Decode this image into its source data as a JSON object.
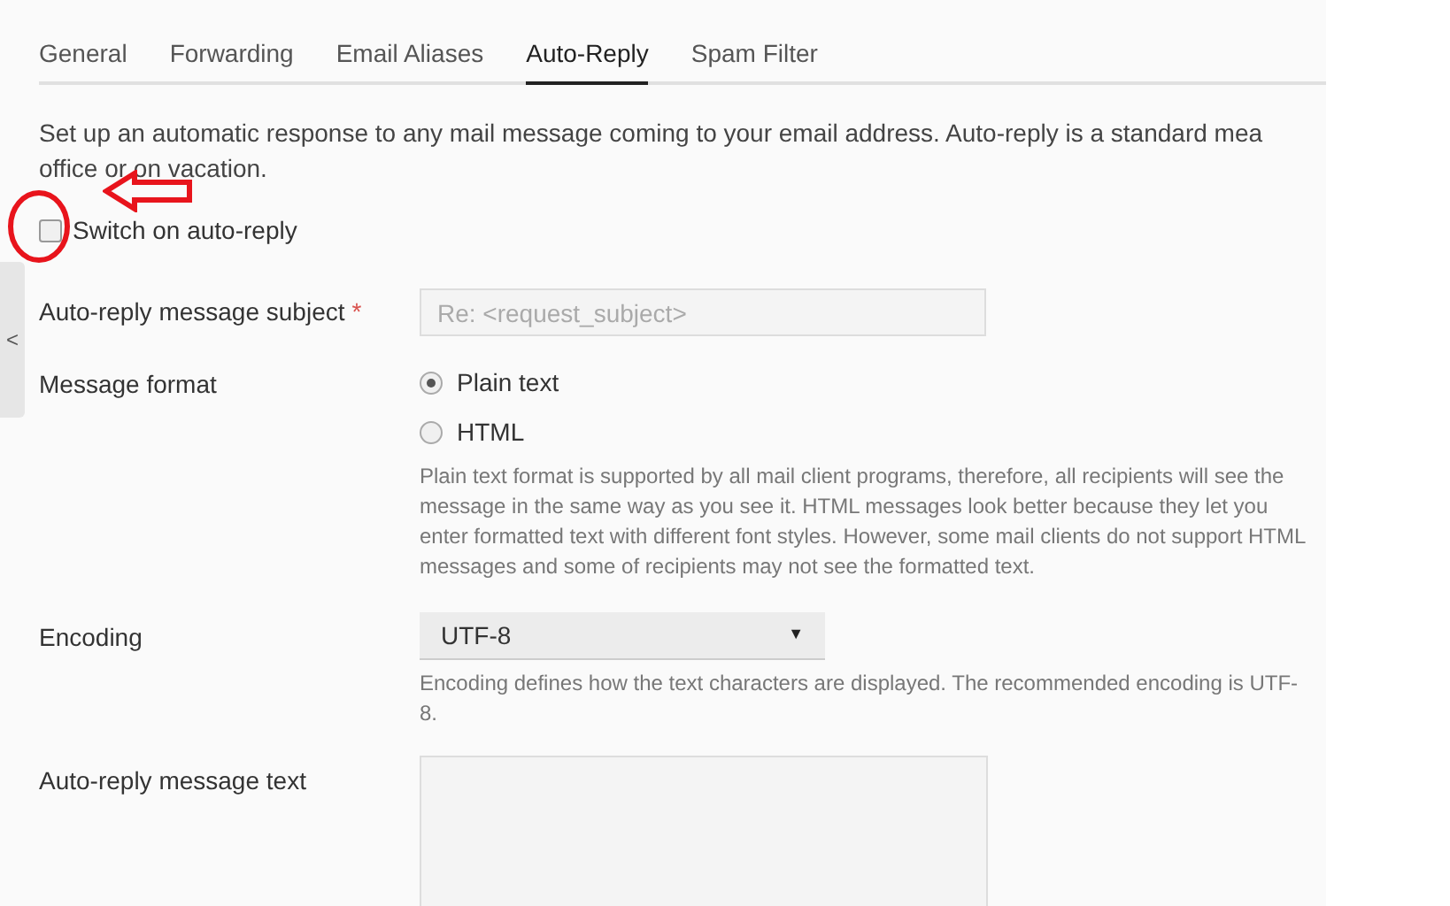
{
  "tabs": [
    {
      "label": "General",
      "selected": false
    },
    {
      "label": "Forwarding",
      "selected": false
    },
    {
      "label": "Email Aliases",
      "selected": false
    },
    {
      "label": "Auto-Reply",
      "selected": true
    },
    {
      "label": "Spam Filter",
      "selected": false
    }
  ],
  "intro": [
    "Set up an automatic response to any mail message coming to your email address. Auto-reply is a standard mea",
    "office or on vacation."
  ],
  "switch": {
    "label": "Switch on auto-reply",
    "checked": false
  },
  "sidebar_toggle": "<",
  "subject": {
    "label": "Auto-reply message subject",
    "required_mark": "*",
    "placeholder": "Re: <request_subject>"
  },
  "format": {
    "label": "Message format",
    "options": [
      {
        "label": "Plain text",
        "selected": true
      },
      {
        "label": "HTML",
        "selected": false
      }
    ],
    "hint": "Plain text format is supported by all mail client programs, therefore, all recipients will see the message in the same way as you see it. HTML messages look better because they let you enter formatted text with different font styles. However, some mail clients do not support HTML messages and some of recipients may not see the formatted text."
  },
  "encoding": {
    "label": "Encoding",
    "value": "UTF-8",
    "arrow": "▼",
    "hint": "Encoding defines how the text characters are displayed. The recommended encoding is UTF-8."
  },
  "message_text": {
    "label": "Auto-reply message text"
  }
}
